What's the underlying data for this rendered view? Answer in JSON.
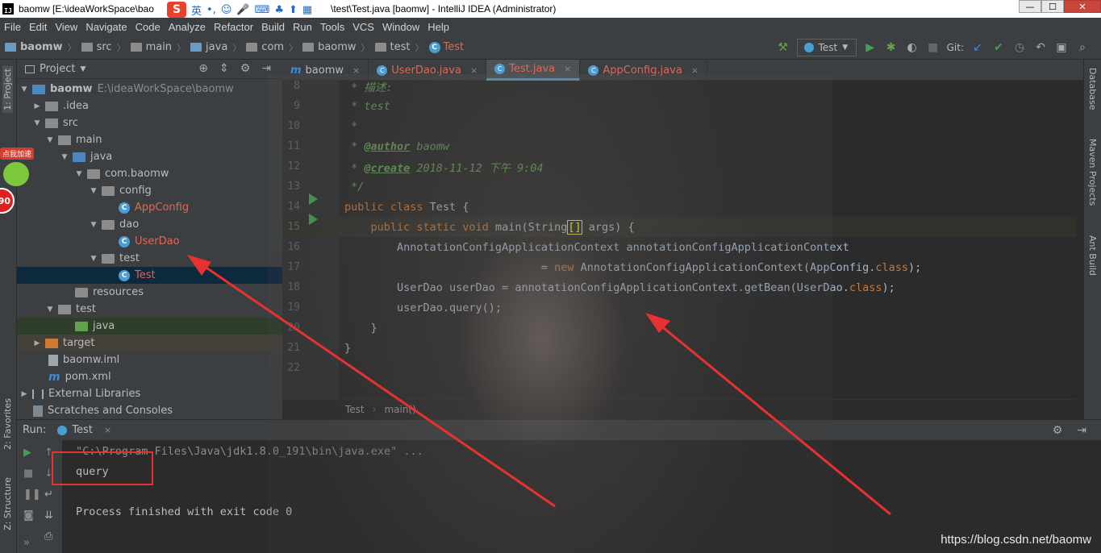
{
  "window": {
    "title_left": "baomw [E:\\ideaWorkSpace\\bao",
    "title_right": "\\test\\Test.java [baomw] - IntelliJ IDEA (Administrator)",
    "ime_lang": "英"
  },
  "menu": [
    "File",
    "Edit",
    "View",
    "Navigate",
    "Code",
    "Analyze",
    "Refactor",
    "Build",
    "Run",
    "Tools",
    "VCS",
    "Window",
    "Help"
  ],
  "breadcrumb": [
    "baomw",
    "src",
    "main",
    "java",
    "com",
    "baomw",
    "test",
    "Test"
  ],
  "toolbar": {
    "run_config": "Test",
    "git_label": "Git:"
  },
  "side_tabs": {
    "project": "1: Project",
    "favorites": "2: Favorites",
    "structure": "Z: Structure",
    "database": "Database",
    "maven": "Maven Projects",
    "ant": "Ant Build"
  },
  "project_panel": {
    "title": "Project",
    "tree": [
      {
        "label": "baomw",
        "extra": "E:\\ideaWorkSpace\\baomw"
      },
      {
        "label": ".idea"
      },
      {
        "label": "src"
      },
      {
        "label": "main"
      },
      {
        "label": "java"
      },
      {
        "label": "com.baomw"
      },
      {
        "label": "config"
      },
      {
        "label": "AppConfig"
      },
      {
        "label": "dao"
      },
      {
        "label": "UserDao"
      },
      {
        "label": "test"
      },
      {
        "label": "Test"
      },
      {
        "label": "resources"
      },
      {
        "label": "test"
      },
      {
        "label": "java"
      },
      {
        "label": "target"
      },
      {
        "label": "baomw.iml"
      },
      {
        "label": "pom.xml"
      },
      {
        "label": "External Libraries"
      },
      {
        "label": "Scratches and Consoles"
      }
    ]
  },
  "badge": {
    "label": "点我加速",
    "value": "90"
  },
  "editor_tabs": [
    "baomw",
    "UserDao.java",
    "Test.java",
    "AppConfig.java"
  ],
  "code": {
    "line_numbers": [
      "8",
      "9",
      "10",
      "11",
      "12",
      "13",
      "14",
      "15",
      "16",
      "17",
      "18",
      "19",
      "20",
      "21",
      "22"
    ],
    "l8": " * 描述:",
    "l9": " * test",
    "l10": " *",
    "l11_pre": " * ",
    "l11_tag": "@author",
    "l11_post": " baomw",
    "l12_pre": " * ",
    "l12_tag": "@create",
    "l12_post": " 2018-11-12 下午 9:04",
    "l13": " */",
    "l14_kw": "public class",
    "l14_tx": " Test {",
    "l15_kw": "    public static void",
    "l15_tx": " main(String",
    "l15_br": "[]",
    "l15_tx2": " args) {",
    "l16": "        AnnotationConfigApplicationContext annotationConfigApplicationContext",
    "l17_pre": "                              = ",
    "l17_kw": "new",
    "l17_tx": " AnnotationConfigApplicationContext(AppConfig.",
    "l17_kw2": "class",
    "l17_end": ");",
    "l18_tx": "        UserDao userDao = annotationConfigApplicationContext.getBean(UserDao.",
    "l18_kw": "class",
    "l18_end": ");",
    "l19": "        userDao.query();",
    "l20": "    }",
    "l21": "}",
    "l22": ""
  },
  "editor_breadcrumb": [
    "Test",
    "main()"
  ],
  "run_panel": {
    "label": "Run:",
    "tab": "Test",
    "console": [
      "\"C:\\Program Files\\Java\\jdk1.8.0_191\\bin\\java.exe\" ...",
      "query",
      "",
      "Process finished with exit code 0"
    ]
  },
  "watermark": "https://blog.csdn.net/baomw",
  "colors": {
    "accent_red": "#e83131",
    "keyword": "#cc7832",
    "comment": "#629755"
  }
}
